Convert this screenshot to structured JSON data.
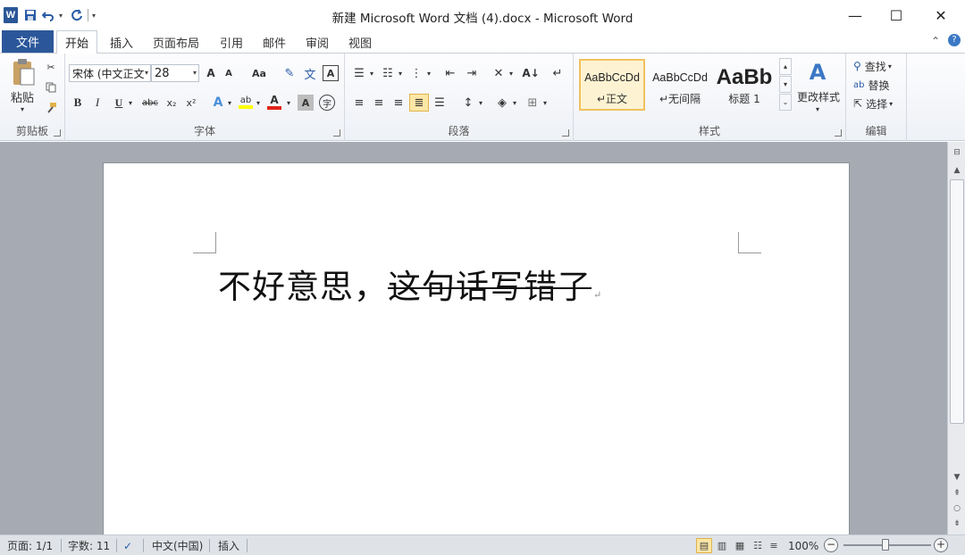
{
  "window": {
    "title": "新建 Microsoft Word 文档 (4).docx - Microsoft Word",
    "app_icon": "W",
    "controls": {
      "minimize": "—",
      "maximize": "☐",
      "close": "✕"
    }
  },
  "qat": {
    "save_icon": "save-icon",
    "undo_icon": "undo-icon",
    "redo_icon": "redo-icon"
  },
  "tabs": {
    "file": "文件",
    "items": [
      "开始",
      "插入",
      "页面布局",
      "引用",
      "邮件",
      "审阅",
      "视图"
    ],
    "active": "开始"
  },
  "ribbon": {
    "clipboard": {
      "label": "剪贴板",
      "paste": "粘贴"
    },
    "font": {
      "label": "字体",
      "font_name": "宋体 (中文正文",
      "font_size": "28",
      "grow": "A",
      "shrink": "A",
      "change_case": "Aa",
      "bold": "B",
      "italic": "I",
      "underline": "U",
      "strike": "abc",
      "sub": "x₂",
      "sup": "x²",
      "highlight_color": "#ffff00",
      "font_color": "#e2231a"
    },
    "paragraph": {
      "label": "段落"
    },
    "styles": {
      "label": "样式",
      "items": [
        {
          "preview": "AaBbCcDd",
          "name": "↵正文"
        },
        {
          "preview": "AaBbCcDd",
          "name": "↵无间隔"
        },
        {
          "preview": "AaBb",
          "name": "标题 1"
        }
      ],
      "change_styles": "更改样式"
    },
    "editing": {
      "label": "编辑",
      "find": "查找",
      "replace": "替换",
      "select": "选择"
    }
  },
  "document": {
    "text_normal": "不好意思，",
    "text_struck": "这句话写错了",
    "para_mark": "↵"
  },
  "status": {
    "page": "页面: 1/1",
    "words": "字数: 11",
    "language": "中文(中国)",
    "mode": "插入",
    "zoom": "100%",
    "zoom_fraction": 0.5
  },
  "colors": {
    "file_tab": "#2b579a",
    "accent": "#2b5797"
  }
}
